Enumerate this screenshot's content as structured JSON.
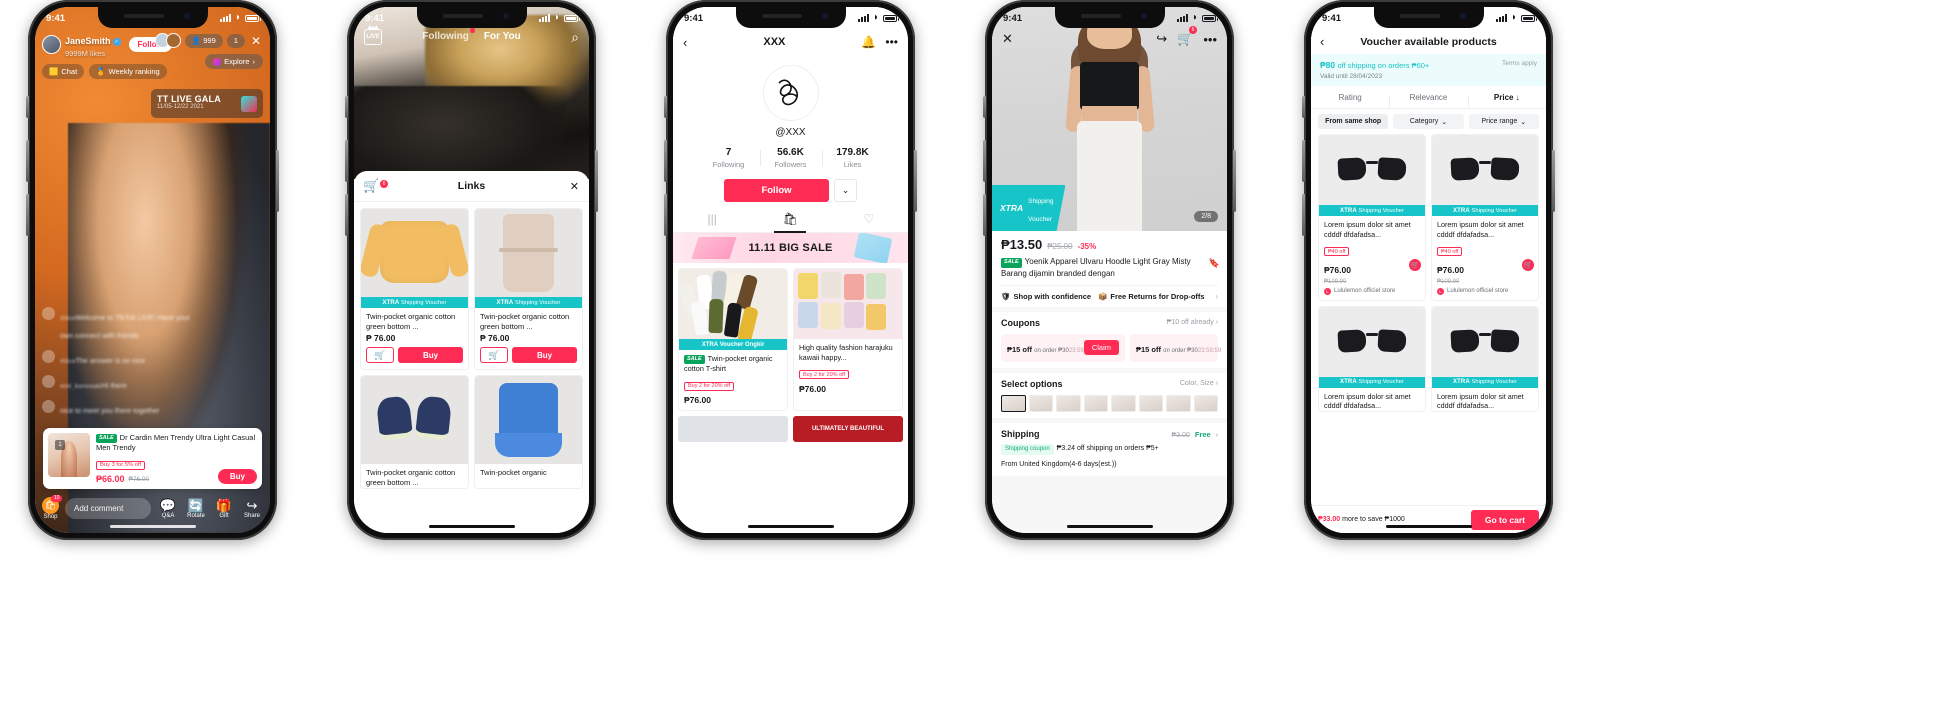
{
  "phones": {
    "p1": {
      "status": {
        "time": "9:41"
      },
      "user": {
        "name": "JaneSmith",
        "likes": "9999M likes",
        "follow": "Follow",
        "verified_icon": "check"
      },
      "chips": [
        {
          "label": "Chat",
          "icon": "chat-icon"
        },
        {
          "label": "Weekly ranking",
          "icon": "trophy-icon"
        }
      ],
      "viewers": {
        "count": "999",
        "more": "1",
        "close_icon": "close-icon"
      },
      "explore": {
        "label": "Explore",
        "chevron": "›"
      },
      "gala": {
        "title": "TT LIVE GALA",
        "dates": "11/05-12/22 2021"
      },
      "messages": [
        {
          "name": "Alice",
          "body": "Welcome to TikTok LIVE! Have your own connect with friends"
        },
        {
          "name": "Alice",
          "body": "The answer is so nice"
        },
        {
          "name": "emi_korosaki",
          "body": "Hi there"
        },
        {
          "name": "emi_kurosaki",
          "body": "nice to meet you there together"
        }
      ],
      "product": {
        "index": "1",
        "sale_tag": "SALE",
        "title": "Dr Cardin Men Trendy Ultra Light Casual Men Trendy",
        "promo": "Buy 3 for 5% off",
        "price": "₱66.00",
        "old_price": "₱76.00",
        "buy": "Buy",
        "close_icon": "close-icon"
      },
      "bottom": {
        "shop_label": "Shop",
        "shop_badge": "10",
        "comment_placeholder": "Add comment",
        "actions": [
          {
            "label": "Q&A",
            "icon": "qa-icon"
          },
          {
            "label": "Rotate",
            "icon": "rotate-icon"
          },
          {
            "label": "Gift",
            "icon": "gift-icon"
          },
          {
            "label": "Share",
            "icon": "share-icon"
          }
        ]
      }
    },
    "p2": {
      "status": {
        "time": "9:41"
      },
      "nav": {
        "live_badge": "LIVE",
        "tabs": [
          "Following",
          "For You"
        ],
        "active_tab": "For You",
        "search_icon": "search-icon"
      },
      "sheet": {
        "title": "Links",
        "cart_badge": "6",
        "cart_icon": "cart-icon",
        "close_icon": "close-icon"
      },
      "items": [
        {
          "voucher": "XTRA",
          "voucher_label": "Shipping Voucher",
          "name": "Twin-pocket organic cotton green bottom ...",
          "price": "₱ 76.00",
          "buy": "Buy",
          "cart_icon": "cart-icon",
          "art": "shirt"
        },
        {
          "voucher": "XTRA",
          "voucher_label": "Shipping Voucher",
          "name": "Twin-pocket organic cotton green bottom ...",
          "price": "₱ 76.00",
          "buy": "Buy",
          "cart_icon": "cart-icon",
          "art": "dress"
        },
        {
          "voucher": "",
          "voucher_label": "",
          "name": "Twin-pocket organic cotton green bottom ...",
          "price": "",
          "buy": "",
          "cart_icon": "",
          "art": "shoe"
        },
        {
          "voucher": "",
          "voucher_label": "",
          "name": "Twin-pocket organic",
          "price": "",
          "buy": "",
          "cart_icon": "",
          "art": "bluedress"
        }
      ]
    },
    "p3": {
      "status": {
        "time": "9:41"
      },
      "header": {
        "back_icon": "back-icon",
        "title": "XXX",
        "bell_icon": "bell-icon",
        "more_icon": "more-icon"
      },
      "handle": "@XXX",
      "stats": [
        {
          "value": "7",
          "label": "Following"
        },
        {
          "value": "56.6K",
          "label": "Followers"
        },
        {
          "value": "179.8K",
          "label": "Likes"
        }
      ],
      "follow": {
        "label": "Follow",
        "chevron_icon": "chevron-down-icon"
      },
      "tabs": [
        {
          "icon": "grid-icon",
          "active": false
        },
        {
          "icon": "bag-icon",
          "active": true
        },
        {
          "icon": "private-heart-icon",
          "active": false
        }
      ],
      "banner": "11.11 BIG SALE",
      "products": [
        {
          "voucher": "XTRA",
          "voucher_label": "Voucher Ongkir",
          "sale_tag": "SALE",
          "name": "Twin-pocket organic cotton T-shirt",
          "promo": "Buy 2 for 20% off",
          "price": "₱76.00",
          "art": "socks"
        },
        {
          "voucher": "",
          "voucher_label": "",
          "sale_tag": "",
          "name": "High quality fashion harajuku kawaii happy...",
          "promo": "Buy 2 for 20% off",
          "price": "₱76.00",
          "art": "bags"
        }
      ],
      "row3": {
        "right_text": "ULTIMATELY BEAUTIFUL"
      }
    },
    "p4": {
      "status": {
        "time": "9:41"
      },
      "topbar": {
        "close_icon": "close-icon",
        "share_icon": "share-icon",
        "cart_icon": "cart-icon",
        "cart_badge": "6",
        "more_icon": "more-icon"
      },
      "pager": "2/8",
      "xtra": {
        "brand": "XTRA",
        "line1": "Shipping",
        "line2": "Voucher"
      },
      "price": "₱13.50",
      "old_price": "₱25.00",
      "discount": "-35%",
      "sale_tag": "SALE",
      "title": "Yoenik Apparel Ulvaru Hoodle Light Gray Misty  Barang dijamin branded dengan",
      "bookmark_icon": "bookmark-icon",
      "trust": [
        {
          "label": "Shop with confidence",
          "icon": "shield-icon"
        },
        {
          "label": "Free Returns for Drop-offs",
          "icon": "return-icon"
        }
      ],
      "coupons_header": "Coupons",
      "coupons_right": "₱10 off already ›",
      "coupons": [
        {
          "amount": "₱15 off",
          "cond": "on order ₱30",
          "timer": "23:59:59",
          "action": "Claim"
        },
        {
          "amount": "₱15 off",
          "cond": "on order ₱30",
          "timer": "23:59:59",
          "action": ""
        }
      ],
      "options_header": "Select options",
      "options_right": "Color, Size ›",
      "shipping_header": "Shipping",
      "shipping_old": "₱3.00",
      "shipping_free": "Free",
      "shipping_coupon": "Shipping coupon",
      "shipping_line": "₱3.24 off shipping on orders ₱5+",
      "shipping_line2": "From United Kingdom(4-6 days(est.))"
    },
    "p5": {
      "status": {
        "time": "9:41"
      },
      "header": {
        "back_icon": "back-icon",
        "title": "Voucher available products"
      },
      "voucher": {
        "amount": "₱80",
        "desc": "off shipping on orders ₱60+",
        "valid": "Valid until 28/04/2023",
        "terms": "Terms apply"
      },
      "sorts": [
        {
          "label": "Rating",
          "active": false
        },
        {
          "label": "Relevance",
          "active": false
        },
        {
          "label": "Price ↓",
          "active": true
        }
      ],
      "filters": [
        {
          "label": "From same shop",
          "chevron": "",
          "active": true
        },
        {
          "label": "Category",
          "chevron": "⌄",
          "active": false
        },
        {
          "label": "Price range",
          "chevron": "⌄",
          "active": false
        }
      ],
      "products": [
        {
          "voucher": "XTRA",
          "voucher_label": "Shipping Voucher",
          "name": "Lorem ipsum dolor sit amet cdddf dfdafadsa...",
          "off": "₱40 off",
          "price": "₱76.00",
          "old_price": "₱109.90",
          "store": "Lululemon officiel store",
          "cart_icon": "cart-icon"
        },
        {
          "voucher": "XTRA",
          "voucher_label": "Shipping Voucher",
          "name": "Lorem ipsum dolor sit amet cdddf dfdafadsa...",
          "off": "₱40 off",
          "price": "₱76.00",
          "old_price": "₱109.90",
          "store": "Lululemon officiel store",
          "cart_icon": "cart-icon"
        },
        {
          "voucher": "XTRA",
          "voucher_label": "Shipping Voucher",
          "name": "Lorem ipsum dolor sit amet cdddf dfdafadsa...",
          "off": "",
          "price": "",
          "old_price": "",
          "store": "",
          "cart_icon": ""
        },
        {
          "voucher": "XTRA",
          "voucher_label": "Shipping Voucher",
          "name": "Lorem ipsum dolor sit amet cdddf dfdafadsa...",
          "off": "",
          "price": "",
          "old_price": "",
          "store": "",
          "cart_icon": ""
        }
      ],
      "bottom": {
        "more_prefix": "₱33.00",
        "more_suffix": " more to save ₱1000",
        "go_cart": "Go to cart"
      }
    }
  },
  "colors": {
    "accent": "#fe2c55",
    "teal": "#17c5c8",
    "green": "#0aa35c"
  }
}
